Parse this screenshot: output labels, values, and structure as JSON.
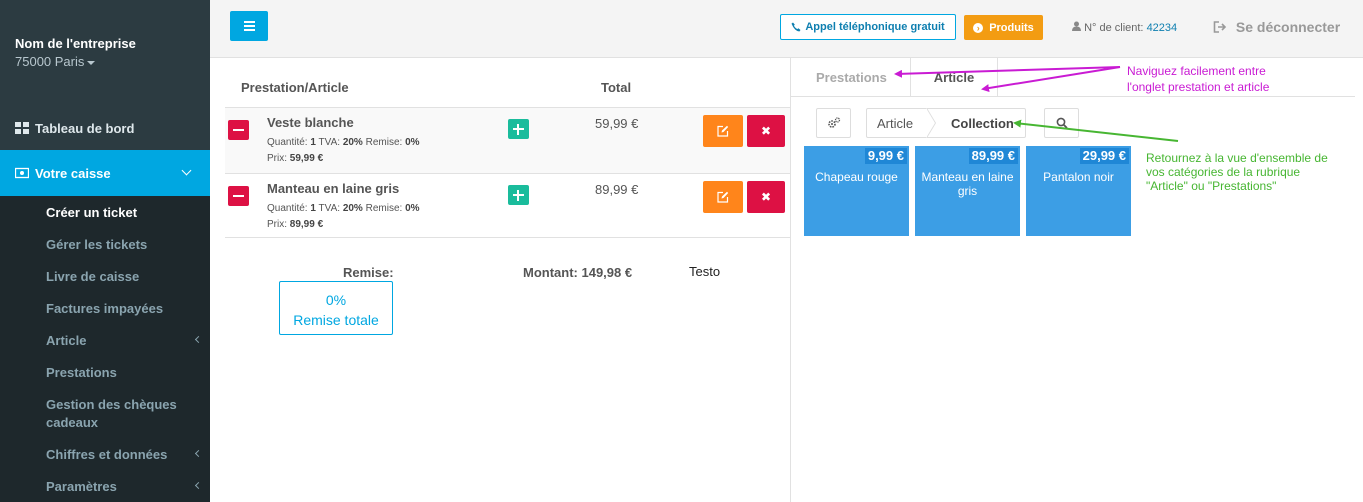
{
  "sidebar": {
    "company_name": "Nom de l'entreprise",
    "location": "75000 Paris",
    "items": [
      {
        "label": "Tableau de bord",
        "icon": "dashboard-icon"
      },
      {
        "label": "Votre caisse",
        "icon": "cash-register-icon",
        "active": true
      }
    ],
    "submenu": [
      {
        "label": "Créer un ticket",
        "active": true
      },
      {
        "label": "Gérer les tickets"
      },
      {
        "label": "Livre de caisse"
      },
      {
        "label": "Factures impayées"
      },
      {
        "label": "Article",
        "has_children": true
      },
      {
        "label": "Prestations"
      },
      {
        "label": "Gestion des chèques cadeaux"
      },
      {
        "label": "Chiffres et données",
        "has_children": true
      },
      {
        "label": "Paramètres",
        "has_children": true
      }
    ]
  },
  "topbar": {
    "call_label": "Appel téléphonique gratuit",
    "products_label": "Produits",
    "client_label": "N° de client:",
    "client_number": "42234",
    "logout_label": "Se déconnecter"
  },
  "ticket": {
    "col_item": "Prestation/Article",
    "col_total": "Total",
    "rows": [
      {
        "name": "Veste blanche",
        "qty_label": "Quantité:",
        "qty": "1",
        "tva_label": "TVA:",
        "tva": "20%",
        "remise_label": "Remise:",
        "remise": "0%",
        "price_label": "Prix:",
        "price": "59,99 €",
        "total": "59,99 €"
      },
      {
        "name": "Manteau en laine gris",
        "qty_label": "Quantité:",
        "qty": "1",
        "tva_label": "TVA:",
        "tva": "20%",
        "remise_label": "Remise:",
        "remise": "0%",
        "price_label": "Prix:",
        "price": "89,99 €",
        "total": "89,99 €"
      }
    ],
    "remise_label": "Remise:",
    "montant_label": "Montant: 149,98 €",
    "note": "Testo",
    "remise_value": "0%",
    "remise_total_label": "Remise totale"
  },
  "catalog": {
    "tabs": [
      "Prestations",
      "Article"
    ],
    "active_tab": "Article",
    "breadcrumb": [
      "Article",
      "Collection"
    ],
    "tiles": [
      {
        "price": "9,99 €",
        "name": "Chapeau rouge"
      },
      {
        "price": "89,99 €",
        "name": "Manteau en laine gris"
      },
      {
        "price": "29,99 €",
        "name": "Pantalon noir"
      }
    ]
  },
  "annotations": {
    "tabs_note": [
      "Naviguez facilement entre",
      "l'onglet prestation et article"
    ],
    "breadcrumb_note": [
      "Retournez à la vue d'ensemble de",
      "vos catégories de la rubrique",
      "\"Article\" ou \"Prestations\""
    ]
  },
  "colors": {
    "sidebar_bg": "#2c3b41",
    "accent": "#00a7e1",
    "orange": "#f39c12",
    "red": "#dd1144",
    "green": "#1abc9c",
    "tile": "#3c9ee5",
    "annotation_magenta": "#c91bd3",
    "annotation_green": "#47b632"
  }
}
